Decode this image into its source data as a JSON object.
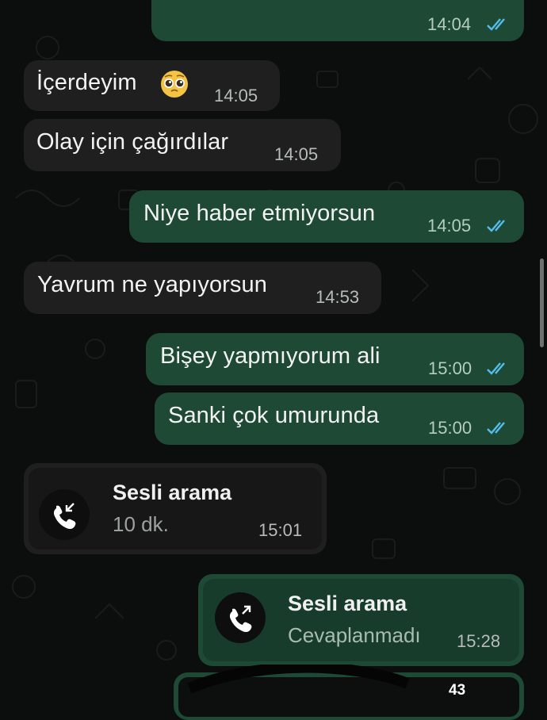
{
  "messages": [
    {
      "id": "m0",
      "direction": "out",
      "text": "",
      "time": "14:04",
      "status": "read"
    },
    {
      "id": "m1",
      "direction": "in",
      "text": "İçerdeyim",
      "emoji": "🥺",
      "time": "14:05"
    },
    {
      "id": "m2",
      "direction": "in",
      "text": "Olay için çağırdılar",
      "time": "14:05"
    },
    {
      "id": "m3",
      "direction": "out",
      "text": "Niye haber etmiyorsun",
      "time": "14:05",
      "status": "read"
    },
    {
      "id": "m4",
      "direction": "in",
      "text": "Yavrum ne yapıyorsun",
      "time": "14:53"
    },
    {
      "id": "m5",
      "direction": "out",
      "text": "Bişey yapmıyorum ali",
      "time": "15:00",
      "status": "read"
    },
    {
      "id": "m6",
      "direction": "out",
      "text": "Sanki çok umurunda",
      "time": "15:00",
      "status": "read"
    }
  ],
  "calls": [
    {
      "id": "c1",
      "direction": "in",
      "title": "Sesli arama",
      "subtitle": "10 dk.",
      "time": "15:01",
      "icon": "incoming-call-icon"
    },
    {
      "id": "c2",
      "direction": "out",
      "title": "Sesli arama",
      "subtitle": "Cevaplanmadı",
      "time": "15:28",
      "icon": "outgoing-call-icon"
    }
  ],
  "partial_message": {
    "text": "43"
  },
  "colors": {
    "background": "#0c0e0d",
    "incoming_bubble": "#1f1f1f",
    "outgoing_bubble": "#1e4a35",
    "read_ticks": "#53bdeb"
  }
}
